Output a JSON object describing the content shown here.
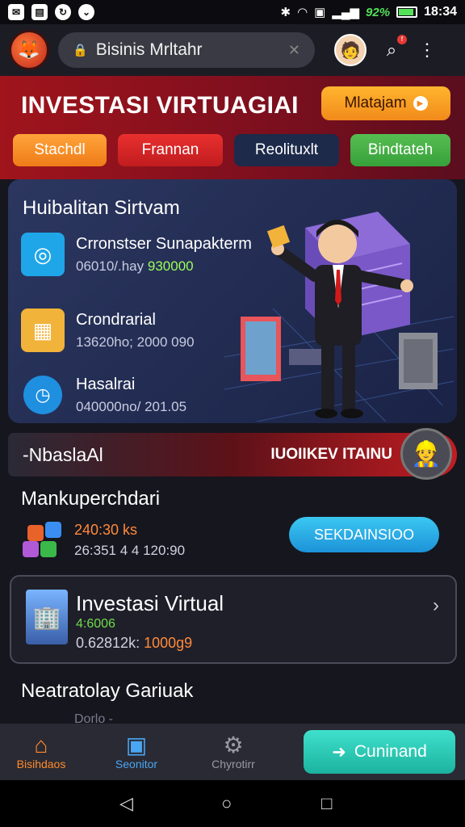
{
  "status_bar": {
    "battery_percent": "92%",
    "time": "18:34",
    "icons": [
      "mail-icon",
      "image-icon",
      "sync-icon",
      "download-icon",
      "bluetooth-icon",
      "wifi-icon",
      "signal-icon"
    ]
  },
  "header": {
    "search_text": "Bisinis Mrltahr",
    "notification_badge": "f"
  },
  "hero": {
    "title": "INVESTASI VIRTUAGIAI",
    "cta_label": "Mlatajam",
    "chips": [
      "Stachdl",
      "Frannan",
      "Reolituxlt",
      "Bindtateh"
    ]
  },
  "panel": {
    "title": "Huibalitan Sirtvam",
    "items": [
      {
        "name": "Crronstser Sunapakterm",
        "sub": "06010/.hay",
        "highlight": "930000"
      },
      {
        "name": "Crondrarial",
        "sub": "13620ho; 2000 090",
        "highlight": ""
      },
      {
        "name": "Hasalrai",
        "sub": "040000no/ 201.05",
        "highlight": ""
      }
    ]
  },
  "promo": {
    "left_label": "-NbaslaAl",
    "right_label": "IUOIIKEV ITAINU"
  },
  "section2": {
    "title": "Mankuperchdari",
    "value": "240:30 ks",
    "sub": "26:351 4 4 120:90",
    "button_label": "SEKDAINSIOO"
  },
  "card": {
    "title": "Investasi Virtual",
    "value": "4:6006",
    "sub_prefix": "0.62812k:",
    "sub_highlight": "1000g9"
  },
  "section3": {
    "title": "Neatratolay Gariuak",
    "sub": "Dorlo   -"
  },
  "bottom_nav": {
    "items": [
      "Bisihdaos",
      "Seonitor",
      "Chyrotirr"
    ],
    "cta_label": "Cuninand"
  },
  "colors": {
    "accent_orange": "#f28a1b",
    "accent_red": "#c11c1f",
    "accent_green": "#36a03a",
    "accent_teal": "#1bb39f",
    "accent_blue": "#1d92d8"
  }
}
